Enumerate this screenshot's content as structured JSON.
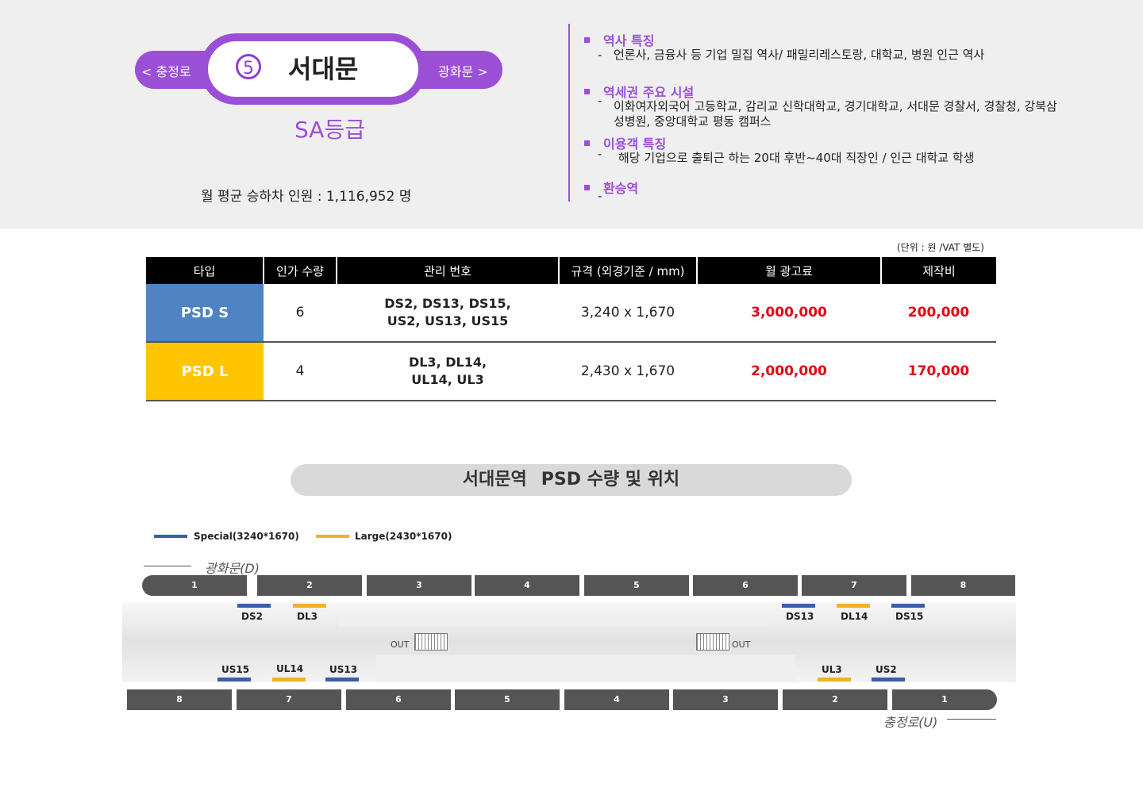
{
  "station": {
    "prev": "< 충정로",
    "next": "광화문 >",
    "line_number": "5",
    "name": "서대문",
    "grade": "SA등급",
    "monthly_riders": "월 평균 승하차 인원 :  1,116,952 명"
  },
  "info": {
    "items": [
      {
        "heading": "역사 특징",
        "text": "언론사, 금융사 등 기업 밀집 역사/ 패밀리레스토랑, 대학교, 병원 인근 역사"
      },
      {
        "heading": "역세권 주요 시설",
        "text": "이화여자외국어 고등학교, 감리교 신학대학교, 경기대학교, 서대문 경찰서, 경찰청, 강북삼성병원, 중앙대학교 평동 캠퍼스"
      },
      {
        "heading": "이용객 특징",
        "text": "해당 기업으로 출퇴근 하는 20대 후반~40대 직장인 / 인근 대학교 학생"
      },
      {
        "heading": "환승역",
        "text": ""
      }
    ],
    "dash": "-"
  },
  "table": {
    "unit_note": "(단위 : 원 /VAT 별도)",
    "headers": [
      "타입",
      "인가 수량",
      "관리 번호",
      "규격 (외경기준 / mm)",
      "월 광고료",
      "제작비"
    ],
    "rows": [
      {
        "type": "PSD S",
        "count": "6",
        "codes_line1": "DS2, DS13, DS15,",
        "codes_line2": "US2, US13, US15",
        "size": "3,240 x 1,670",
        "monthly_fee": "3,000,000",
        "production_fee": "200,000"
      },
      {
        "type": "PSD L",
        "count": "4",
        "codes_line1": "DL3, DL14,",
        "codes_line2": "UL14, UL3",
        "size": "2,430 x 1,670",
        "monthly_fee": "2,000,000",
        "production_fee": "170,000"
      }
    ]
  },
  "map": {
    "title_a": "서대문역",
    "title_b": "PSD 수량 및 위치",
    "legend": [
      {
        "label": "Special(3240*1670)",
        "color": "#3a5fa8"
      },
      {
        "label": "Large(2430*1670)",
        "color": "#f0b323"
      }
    ],
    "direction_top": "광화문(D)",
    "direction_bottom": "충정로(U)",
    "top_cars": [
      "1",
      "2",
      "3",
      "4",
      "5",
      "6",
      "7",
      "8"
    ],
    "bottom_cars": [
      "8",
      "7",
      "6",
      "5",
      "4",
      "3",
      "2",
      "1"
    ],
    "top_doors": [
      "DS2",
      "DL3",
      "DS13",
      "DL14",
      "DS15"
    ],
    "bottom_doors": [
      "US15",
      "UL14",
      "US13",
      "UL3",
      "US2"
    ],
    "exit_label": "OUT"
  }
}
